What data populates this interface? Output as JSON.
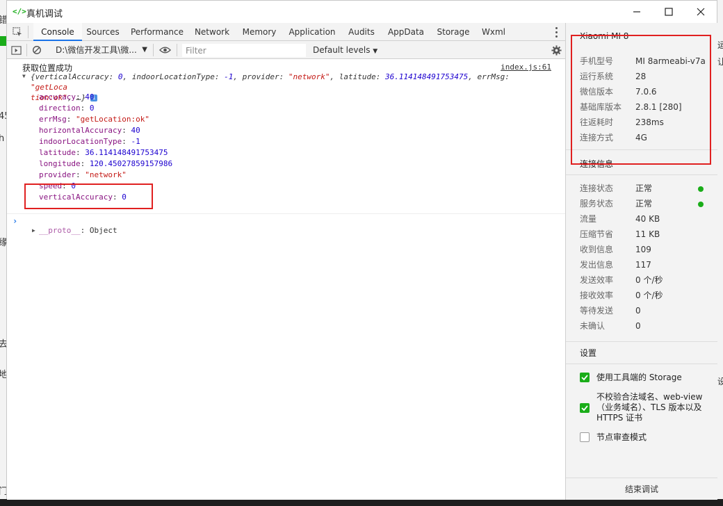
{
  "window": {
    "title": "真机调试",
    "minimize_icon": "minimize-icon",
    "maximize_icon": "maximize-icon",
    "close_icon": "close-icon"
  },
  "background_fragments": {
    "left": [
      "错",
      "45",
      "h",
      "缘",
      "去",
      "地",
      "门"
    ],
    "right": [
      "运",
      "让",
      "设"
    ]
  },
  "devtools": {
    "tabs": [
      {
        "label": "Console",
        "active": true
      },
      {
        "label": "Sources"
      },
      {
        "label": "Performance"
      },
      {
        "label": "Network"
      },
      {
        "label": "Memory"
      },
      {
        "label": "Application"
      },
      {
        "label": "Audits"
      },
      {
        "label": "AppData"
      },
      {
        "label": "Storage"
      },
      {
        "label": "Wxml"
      }
    ],
    "toolbar": {
      "context": "D:\\微信开发工具\\微...",
      "filter_placeholder": "Filter",
      "levels": "Default levels"
    },
    "console": {
      "message": "获取位置成功",
      "source": "index.js:61",
      "summary_line1_prefix": "{verticalAccuracy: ",
      "summary_va": "0",
      "summary_ilt_key": ", indoorLocationType: ",
      "summary_ilt": "-1",
      "summary_provider_key": ", provider: ",
      "summary_provider": "\"network\"",
      "summary_lat_key": ", latitude: ",
      "summary_lat": "36.114148491753475",
      "summary_err_key": ", errMsg: ",
      "summary_err_a": "\"getLoca",
      "summary_err_b": "tion:ok\"",
      "summary_tail": ", …}",
      "info_badge": "i",
      "properties": [
        {
          "key": "accuracy",
          "value": "40",
          "type": "num"
        },
        {
          "key": "direction",
          "value": "0",
          "type": "num"
        },
        {
          "key": "errMsg",
          "value": "\"getLocation:ok\"",
          "type": "str"
        },
        {
          "key": "horizontalAccuracy",
          "value": "40",
          "type": "num"
        },
        {
          "key": "indoorLocationType",
          "value": "-1",
          "type": "num"
        },
        {
          "key": "latitude",
          "value": "36.114148491753475",
          "type": "num"
        },
        {
          "key": "longitude",
          "value": "120.45027859157986",
          "type": "num"
        },
        {
          "key": "provider",
          "value": "\"network\"",
          "type": "str"
        },
        {
          "key": "speed",
          "value": "0",
          "type": "num"
        },
        {
          "key": "verticalAccuracy",
          "value": "0",
          "type": "num"
        }
      ],
      "proto_key": "__proto__",
      "proto_value": "Object",
      "prompt": "›"
    }
  },
  "side": {
    "device_name": "Xiaomi MI 8",
    "device_info": [
      {
        "key": "手机型号",
        "value": "MI 8armeabi-v7a"
      },
      {
        "key": "运行系统",
        "value": "28"
      },
      {
        "key": "微信版本",
        "value": "7.0.6"
      },
      {
        "key": "基础库版本",
        "value": "2.8.1 [280]"
      },
      {
        "key": "往返耗时",
        "value": "238ms"
      },
      {
        "key": "连接方式",
        "value": "4G"
      }
    ],
    "connection_header": "连接信息",
    "connection_info": [
      {
        "key": "连接状态",
        "value": "正常",
        "dot": true
      },
      {
        "key": "服务状态",
        "value": "正常",
        "dot": true
      },
      {
        "key": "流量",
        "value": "40 KB"
      },
      {
        "key": "压缩节省",
        "value": "11 KB"
      },
      {
        "key": "收到信息",
        "value": "109"
      },
      {
        "key": "发出信息",
        "value": "117"
      },
      {
        "key": "发送效率",
        "value": "0 个/秒"
      },
      {
        "key": "接收效率",
        "value": "0 个/秒"
      },
      {
        "key": "等待发送",
        "value": "0"
      },
      {
        "key": "未确认",
        "value": "0"
      }
    ],
    "settings_header": "设置",
    "settings": [
      {
        "label": "使用工具端的 Storage",
        "checked": true
      },
      {
        "label": "不校验合法域名、web-view（业务域名）、TLS 版本以及 HTTPS 证书",
        "checked": true
      },
      {
        "label": "节点审查模式",
        "checked": false
      }
    ],
    "end_button": "结束调试"
  },
  "colors": {
    "accent_green": "#1aad19",
    "highlight_red": "#e02020",
    "tab_active": "#1a73e8"
  }
}
